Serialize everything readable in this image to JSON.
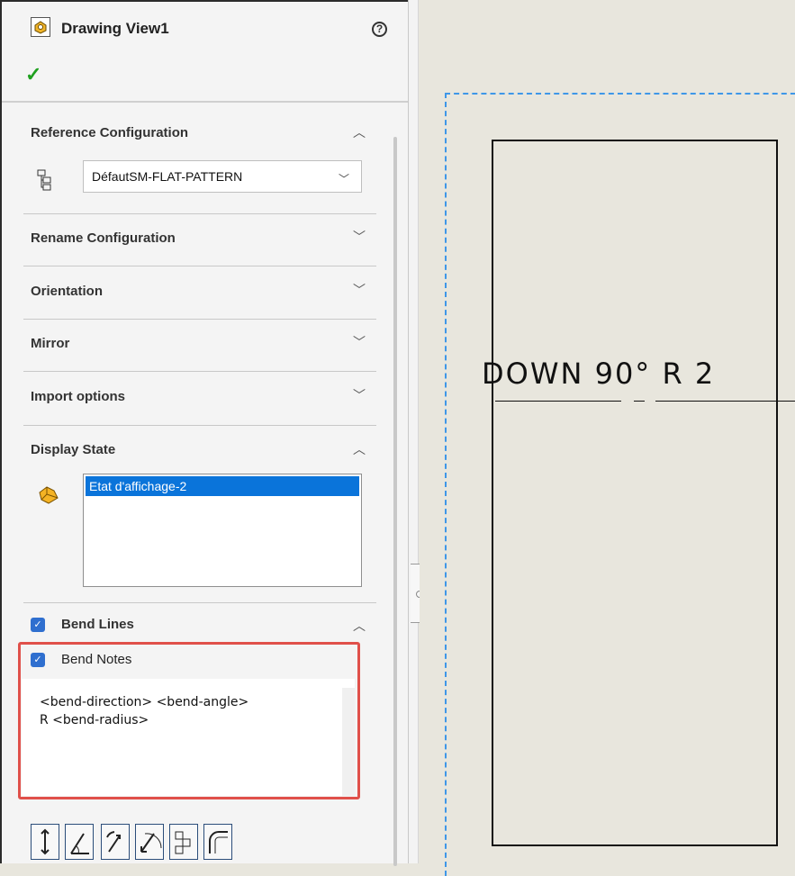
{
  "panel": {
    "title": "Drawing View1",
    "help_icon": "?",
    "ok_icon": "✓"
  },
  "sections": {
    "reference_configuration": {
      "label": "Reference Configuration",
      "state": "expanded",
      "selected_value": "DéfautSM-FLAT-PATTERN"
    },
    "rename_configuration": {
      "label": "Rename Configuration",
      "state": "collapsed"
    },
    "orientation": {
      "label": "Orientation",
      "state": "collapsed"
    },
    "mirror": {
      "label": "Mirror",
      "state": "collapsed"
    },
    "import_options": {
      "label": "Import options",
      "state": "collapsed"
    },
    "display_state": {
      "label": "Display State",
      "state": "expanded",
      "items": [
        "Etat d'affichage-2"
      ],
      "selected_index": 0
    },
    "bend_lines": {
      "label": "Bend Lines",
      "checked": true,
      "state": "expanded"
    },
    "bend_notes": {
      "label": "Bend Notes",
      "checked": true,
      "text": "<bend-direction> <bend-angle>\nR <bend-radius>"
    }
  },
  "toolbar_icons": [
    "bend-direction-icon",
    "bend-angle-icon",
    "bend-order-icon",
    "bend-radius-icon",
    "sheet-metal-gauge-icon",
    "bend-allowance-icon"
  ],
  "canvas": {
    "bend_note_text": "DOWN  90°  R 2"
  },
  "colors": {
    "accent": "#0a74da",
    "checkbox": "#2f6fcf",
    "highlight": "#e0504a",
    "ok": "#1fa01f",
    "canvas_bg": "#e8e6dd",
    "view_border": "#3e97e8"
  }
}
